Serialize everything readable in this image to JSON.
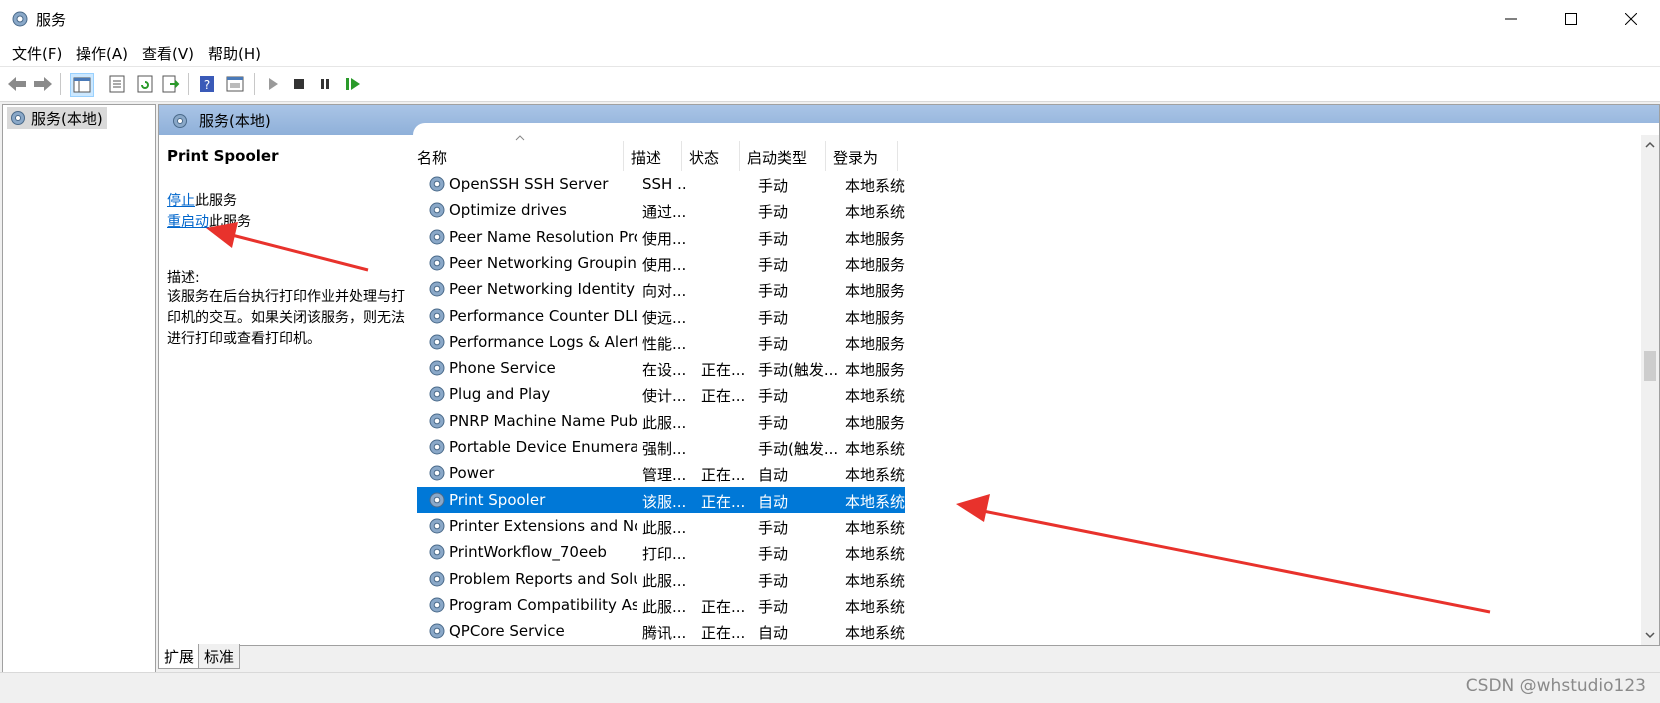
{
  "window": {
    "title": "服务",
    "controls": [
      "minimize",
      "maximize",
      "close"
    ]
  },
  "menu": {
    "items": [
      "文件(F)",
      "操作(A)",
      "查看(V)",
      "帮助(H)"
    ]
  },
  "toolbar": {
    "icons": [
      "back-icon",
      "forward-icon",
      "console-tree-icon",
      "properties-icon",
      "refresh-icon",
      "export-icon",
      "help-icon",
      "view-icon",
      "start-service-icon",
      "stop-service-icon",
      "pause-service-icon",
      "resume-service-icon"
    ]
  },
  "tree": {
    "root_label": "服务(本地)"
  },
  "main": {
    "header_title": "服务(本地)",
    "selected_service_title": "Print Spooler",
    "stop_link": "停止",
    "stop_suffix": "此服务",
    "restart_link": "重启动",
    "restart_suffix": "此服务",
    "desc_label": "描述:",
    "desc_text": "该服务在后台执行打印作业并处理与打印机的交互。如果关闭该服务，则无法进行打印或查看打印机。"
  },
  "list": {
    "columns": [
      "名称",
      "描述",
      "状态",
      "启动类型",
      "登录为"
    ],
    "rows": [
      {
        "name": "OpenSSH SSH Server",
        "desc": "SSH ...",
        "status": "",
        "startup": "手动",
        "logon": "本地系统"
      },
      {
        "name": "Optimize drives",
        "desc": "通过...",
        "status": "",
        "startup": "手动",
        "logon": "本地系统"
      },
      {
        "name": "Peer Name Resolution Pro...",
        "desc": "使用...",
        "status": "",
        "startup": "手动",
        "logon": "本地服务"
      },
      {
        "name": "Peer Networking Grouping",
        "desc": "使用...",
        "status": "",
        "startup": "手动",
        "logon": "本地服务"
      },
      {
        "name": "Peer Networking Identity ...",
        "desc": "向对...",
        "status": "",
        "startup": "手动",
        "logon": "本地服务"
      },
      {
        "name": "Performance Counter DLL ...",
        "desc": "使远...",
        "status": "",
        "startup": "手动",
        "logon": "本地服务"
      },
      {
        "name": "Performance Logs & Alerts",
        "desc": "性能...",
        "status": "",
        "startup": "手动",
        "logon": "本地服务"
      },
      {
        "name": "Phone Service",
        "desc": "在设...",
        "status": "正在...",
        "startup": "手动(触发...",
        "logon": "本地服务"
      },
      {
        "name": "Plug and Play",
        "desc": "使计...",
        "status": "正在...",
        "startup": "手动",
        "logon": "本地系统"
      },
      {
        "name": "PNRP Machine Name Publ...",
        "desc": "此服...",
        "status": "",
        "startup": "手动",
        "logon": "本地服务"
      },
      {
        "name": "Portable Device Enumerat...",
        "desc": "强制...",
        "status": "",
        "startup": "手动(触发...",
        "logon": "本地系统"
      },
      {
        "name": "Power",
        "desc": "管理...",
        "status": "正在...",
        "startup": "自动",
        "logon": "本地系统"
      },
      {
        "name": "Print Spooler",
        "desc": "该服...",
        "status": "正在...",
        "startup": "自动",
        "logon": "本地系统",
        "selected": true
      },
      {
        "name": "Printer Extensions and Noti...",
        "desc": "此服...",
        "status": "",
        "startup": "手动",
        "logon": "本地系统"
      },
      {
        "name": "PrintWorkflow_70eeb",
        "desc": "打印...",
        "status": "",
        "startup": "手动",
        "logon": "本地系统"
      },
      {
        "name": "Problem Reports and Solut...",
        "desc": "此服...",
        "status": "",
        "startup": "手动",
        "logon": "本地系统"
      },
      {
        "name": "Program Compatibility Assi...",
        "desc": "此服...",
        "status": "正在...",
        "startup": "手动",
        "logon": "本地系统"
      },
      {
        "name": "QPCore Service",
        "desc": "腾讯...",
        "status": "正在...",
        "startup": "自动",
        "logon": "本地系统"
      }
    ]
  },
  "tabs": [
    "扩展",
    "标准"
  ],
  "watermark": "CSDN @whstudio123",
  "colors": {
    "selection": "#0078d7",
    "link": "#0066cc",
    "header_blue": "#99b8e0",
    "annotation_arrow": "#e8322c"
  }
}
